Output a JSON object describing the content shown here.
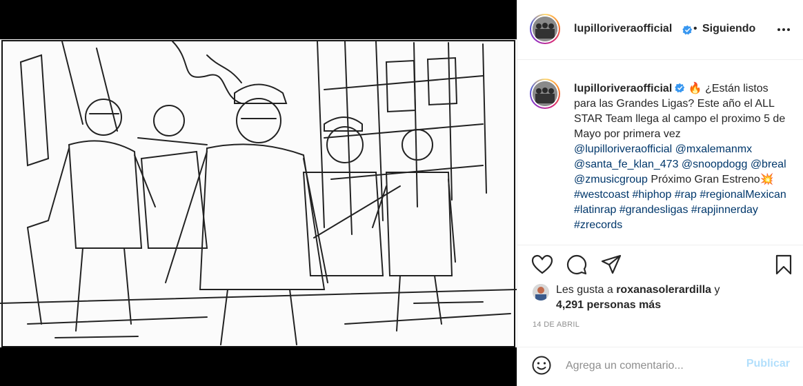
{
  "post": {
    "username": "lupilloriveraofficial",
    "separator": "•",
    "follow_status": "Siguiendo",
    "caption": {
      "text_1": "🔥 ¿Están listos para las Grandes Ligas? Este año el ALL STAR Team llega al campo el proximo 5 de Mayo por primera vez",
      "mention_1": "@lupilloriveraofficial",
      "mention_2": "@mxalemanmx",
      "mention_3": "@santa_fe_klan_473",
      "mention_4": "@snoopdogg",
      "mention_5": "@breal",
      "mention_6": "@zmusicgroup",
      "text_2": "Próximo Gran Estreno💥",
      "hashtag_1": "#westcoast",
      "hashtag_2": "#hiphop",
      "hashtag_3": "#rap",
      "hashtag_4": "#regionalMexican",
      "hashtag_5": "#latinrap",
      "hashtag_6": "#grandesligas",
      "hashtag_7": "#rapjinnerday",
      "hashtag_8": "#zrecords"
    },
    "likes": {
      "prefix": "Les gusta a",
      "liker": "roxanasolerardilla",
      "conjunction": "y",
      "count_text": "4,291 personas más"
    },
    "date": "14 DE ABRIL",
    "comment": {
      "placeholder": "Agrega un comentario...",
      "publish_label": "Publicar"
    }
  },
  "icons": {
    "verified": "verified-badge-icon",
    "more": "more-options-icon",
    "like": "heart-icon",
    "comment": "comment-icon",
    "share": "share-icon",
    "save": "bookmark-icon",
    "emoji": "emoji-icon"
  },
  "colors": {
    "link": "#00376b",
    "verified": "#3897f0",
    "publish_disabled": "#b2dffc",
    "muted": "#8e8e8e"
  }
}
